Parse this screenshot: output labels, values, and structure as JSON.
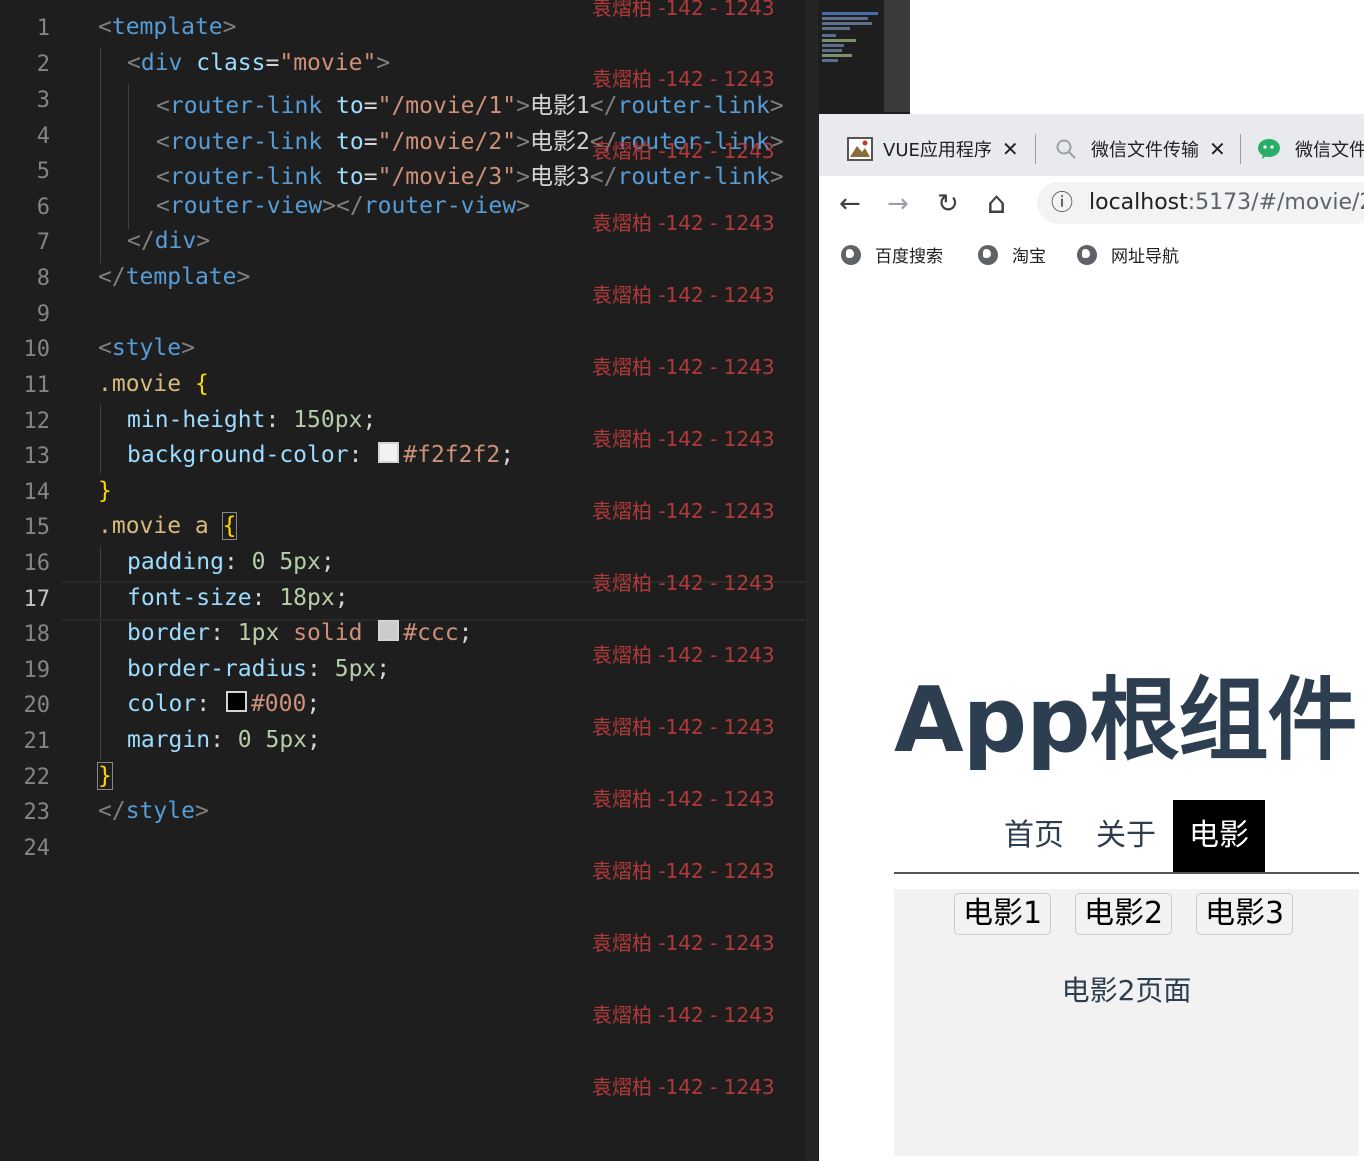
{
  "editor": {
    "line_numbers": [
      "1",
      "2",
      "3",
      "4",
      "5",
      "6",
      "7",
      "8",
      "9",
      "10",
      "11",
      "12",
      "13",
      "14",
      "15",
      "16",
      "17",
      "18",
      "19",
      "20",
      "21",
      "22",
      "23",
      "24"
    ],
    "active_line": "17",
    "code": {
      "l1": {
        "open": "<",
        "tag": "template",
        "close": ">"
      },
      "l2": {
        "open": "<",
        "tag": "div",
        "attr": " class",
        "eq": "=",
        "str": "\"movie\"",
        "close": ">"
      },
      "l3": {
        "open": "<",
        "tag": "router-link",
        "attr": " to",
        "eq": "=",
        "str": "\"/movie/1\"",
        "close": ">",
        "text": "电影1",
        "end_open": "</",
        "end_tag": "router-link",
        "end_close": ">"
      },
      "l4": {
        "open": "<",
        "tag": "router-link",
        "attr": " to",
        "eq": "=",
        "str": "\"/movie/2\"",
        "close": ">",
        "text": "电影2",
        "end_open": "</",
        "end_tag": "router-link",
        "end_close": ">"
      },
      "l5": {
        "open": "<",
        "tag": "router-link",
        "attr": " to",
        "eq": "=",
        "str": "\"/movie/3\"",
        "close": ">",
        "text": "电影3",
        "end_open": "</",
        "end_tag": "router-link",
        "end_close": ">"
      },
      "l6": {
        "open": "<",
        "tag": "router-view",
        "close": ">",
        "end_open": "</",
        "end_tag": "router-view",
        "end_close": ">"
      },
      "l7": {
        "open": "</",
        "tag": "div",
        "close": ">"
      },
      "l8": {
        "open": "</",
        "tag": "template",
        "close": ">"
      },
      "l10": {
        "open": "<",
        "tag": "style",
        "close": ">"
      },
      "l11": {
        "sel": ".movie ",
        "brace": "{"
      },
      "l12": {
        "prop": "min-height",
        "colon": ": ",
        "num": "150px",
        "semi": ";"
      },
      "l13": {
        "prop": "background-color",
        "colon": ": ",
        "swatch": "#f2f2f2",
        "val": "#f2f2f2",
        "semi": ";"
      },
      "l14": {
        "brace": "}"
      },
      "l15": {
        "sel": ".movie a ",
        "brace": "{"
      },
      "l16": {
        "prop": "padding",
        "colon": ": ",
        "num": "0 5px",
        "semi": ";"
      },
      "l17": {
        "prop": "font-size",
        "colon": ": ",
        "num": "18px",
        "semi": ";"
      },
      "l18": {
        "prop": "border",
        "colon": ": ",
        "num": "1px",
        "val_word": " solid ",
        "swatch": "#cccccc",
        "val": "#ccc",
        "semi": ";"
      },
      "l19": {
        "prop": "border-radius",
        "colon": ": ",
        "num": "5px",
        "semi": ";"
      },
      "l20": {
        "prop": "color",
        "colon": ": ",
        "swatch": "#000000",
        "val": "#000",
        "semi": ";"
      },
      "l21": {
        "prop": "margin",
        "colon": ": ",
        "num": "0 5px",
        "semi": ";"
      },
      "l22": {
        "brace": "}"
      },
      "l23": {
        "open": "</",
        "tag": "style",
        "close": ">"
      }
    },
    "watermark": "袁熠柏 -142 - 1243"
  },
  "browser": {
    "tabs": [
      {
        "title": "VUE应用程序",
        "close": "✕"
      },
      {
        "title": "微信文件传输",
        "close": "✕"
      },
      {
        "title": "微信文件"
      }
    ],
    "nav": {
      "back": "←",
      "forward": "→",
      "reload": "↻",
      "home": "⌂",
      "info": "ⓘ"
    },
    "url": {
      "host": "localhost",
      "rest": ":5173/#/movie/2"
    },
    "bookmarks": [
      "百度搜索",
      "淘宝",
      "网址导航"
    ]
  },
  "app": {
    "title": "App根组件",
    "nav_links": [
      "首页",
      "关于",
      "电影"
    ],
    "active_nav": "电影",
    "movie_links": [
      "电影1",
      "电影2",
      "电影3"
    ],
    "movie_page_text": "电影2页面"
  },
  "colors": {
    "editor_bg": "#1e1e1e",
    "tag": "#569cd6",
    "attribute": "#9cdcfe",
    "string": "#ce9178",
    "number": "#b5cea8",
    "selector": "#d7ba7d",
    "brace": "#ffd700",
    "watermark": "#b33a3a",
    "app_title": "#2c3e50",
    "movie_bg": "#f2f2f2"
  }
}
